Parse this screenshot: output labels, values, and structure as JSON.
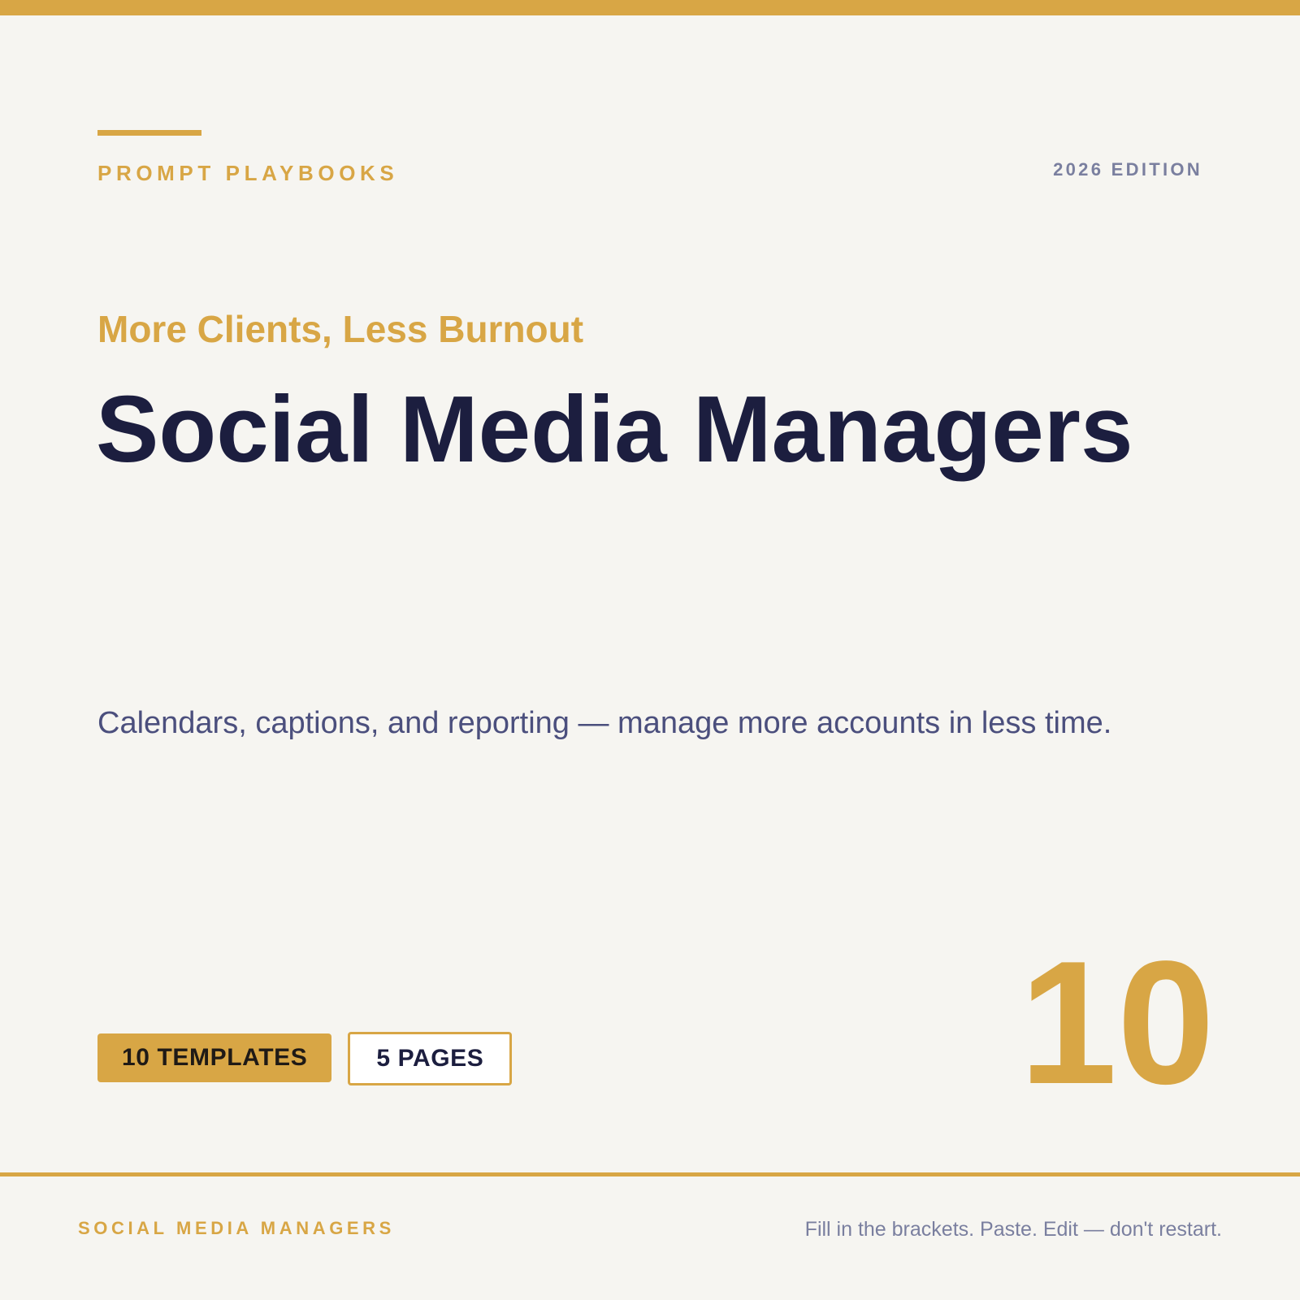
{
  "header": {
    "brand": "PROMPT PLAYBOOKS",
    "edition": "2026 EDITION"
  },
  "hero": {
    "tagline": "More Clients, Less Burnout",
    "title": "Social Media Managers",
    "description": "Calendars, captions, and reporting — manage more accounts in less time."
  },
  "badges": {
    "templates": "10 TEMPLATES",
    "pages": "5 PAGES"
  },
  "big_number": "10",
  "footer": {
    "left": "SOCIAL MEDIA MANAGERS",
    "right": "Fill in the brackets. Paste. Edit — don't restart."
  },
  "colors": {
    "accent": "#d8a645",
    "navy": "#1c1e3f",
    "muted": "#7a7f9f",
    "background": "#f6f5f1"
  }
}
